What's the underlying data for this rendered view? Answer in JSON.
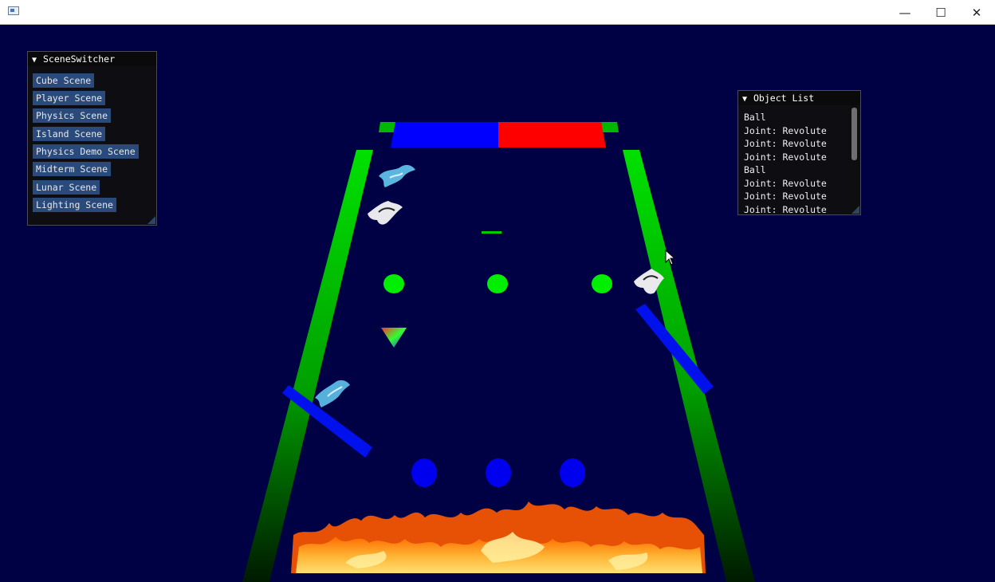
{
  "colors": {
    "background": "#000044",
    "wall_green": "#00dd00",
    "goal_blue": "#0000ff",
    "goal_red": "#ff0000",
    "peg_green": "#00ee00",
    "peg_blue": "#0000ee",
    "flipper_blue": "#0011ee",
    "imgui_button": "#294a7a",
    "imgui_bg": "#0f0f0f"
  },
  "window": {
    "minimize_glyph": "—",
    "maximize_glyph": "☐",
    "close_glyph": "✕"
  },
  "scene_switcher": {
    "title": "SceneSwitcher",
    "collapse_glyph": "▼",
    "buttons": [
      "Cube Scene",
      "Player Scene",
      "Physics Scene",
      "Island Scene",
      "Physics Demo Scene",
      "Midterm Scene",
      "Lunar Scene",
      "Lighting Scene"
    ]
  },
  "object_list": {
    "title": "Object List",
    "collapse_glyph": "▼",
    "items": [
      "Ball",
      "Joint: Revolute",
      "Joint: Revolute",
      "Joint: Revolute",
      "Ball",
      "Joint: Revolute",
      "Joint: Revolute",
      "Joint: Revolute"
    ],
    "scroll_position": 0
  },
  "scene": {
    "icons": [
      "fire-floor",
      "blue-figure-sprite",
      "white-figure-sprite",
      "rgb-triangle",
      "green-peg",
      "blue-peg",
      "blue-flipper",
      "green-wall",
      "goal-bar"
    ]
  }
}
